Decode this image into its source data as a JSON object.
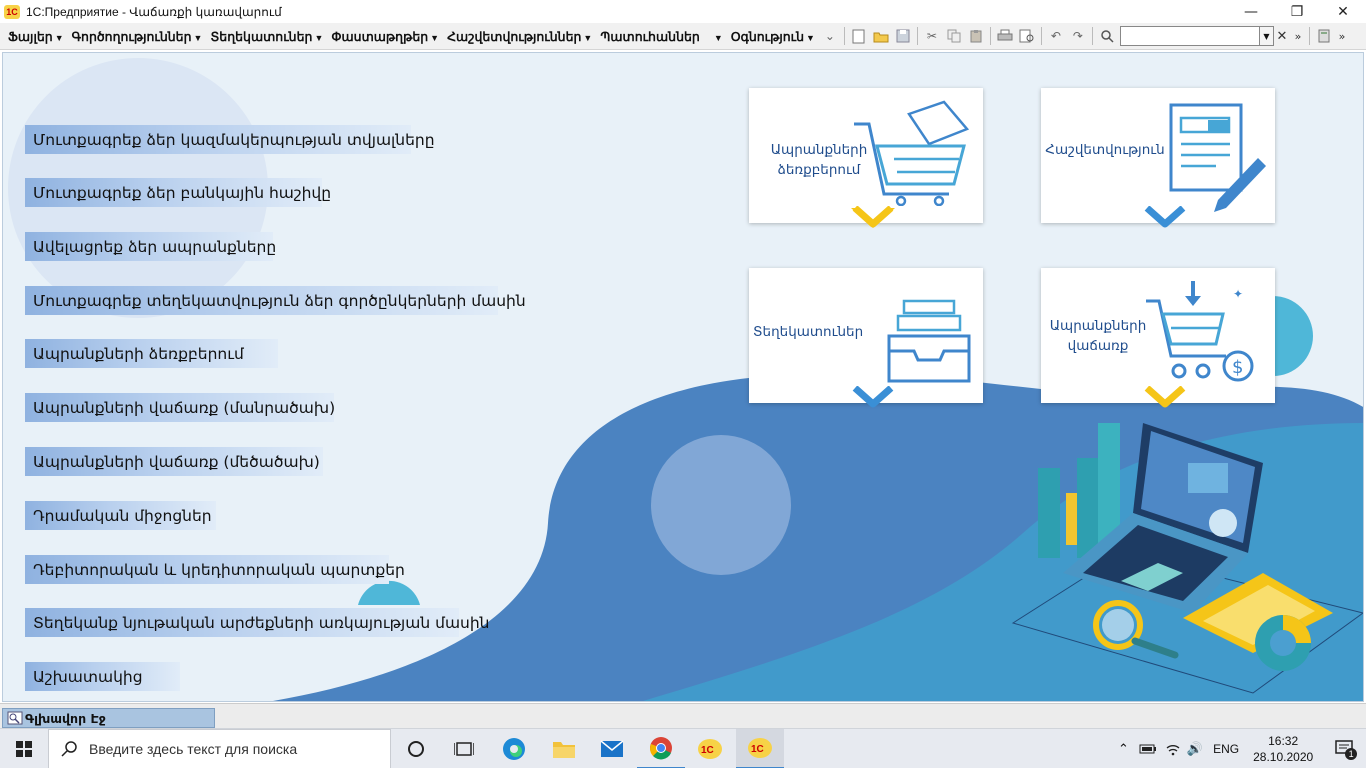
{
  "window": {
    "title": "1C:Предприятие - Վաճառքի կառավարում",
    "logo_text": "1С",
    "minimize": "—",
    "maximize": "❐",
    "close": "✕"
  },
  "menu": {
    "items": [
      {
        "label": "Ֆայլեր"
      },
      {
        "label": "Գործողություններ"
      },
      {
        "label": "Տեղեկատուներ"
      },
      {
        "label": "Փաստաթղթեր"
      },
      {
        "label": "Հաշվետվություններ"
      },
      {
        "label": "Պատուհաններ"
      },
      {
        "label": "Օգնություն"
      }
    ],
    "search_value": ""
  },
  "nav": {
    "links": [
      "Մուտքագրեք ձեր կազմակերպության տվյալները",
      "Մուտքագրեք ձեր բանկային հաշիվը",
      "Ավելացրեք ձեր ապրանքները",
      "Մուտքագրեք տեղեկատվություն ձեր գործընկերների մասին",
      "Ապրանքների  ձեռքբերում",
      "Ապրանքների վաճառք (մանրածախ)",
      "Ապրանքների վաճառք (մեծածախ)",
      "Դրամական միջոցներ",
      "Դեբիտորական և կրեդիտորական պարտքեր",
      "Տեղեկանք նյութական արժեքների առկայության մասին",
      "Աշխատակից"
    ]
  },
  "tiles": {
    "purchase": {
      "line1": "Ապրանքների",
      "line2": "ձեռքբերում"
    },
    "report": {
      "line1": "Հաշվետվություն"
    },
    "directories": {
      "line1": "Տեղեկատուներ"
    },
    "sales": {
      "line1": "Ապրանքների",
      "line2": "վաճառք"
    }
  },
  "section_tab": {
    "label": "Գլխավոր Էջ"
  },
  "taskbar": {
    "search_placeholder": "Введите здесь текст для поиска",
    "language": "ENG",
    "time": "16:32",
    "date": "28.10.2020",
    "notification_count": "1"
  },
  "colors": {
    "accent_blue": "#3f86cc",
    "tile_text": "#1f4c8c",
    "chevron_yellow": "#f5c518",
    "chevron_blue": "#3a8fd6"
  }
}
